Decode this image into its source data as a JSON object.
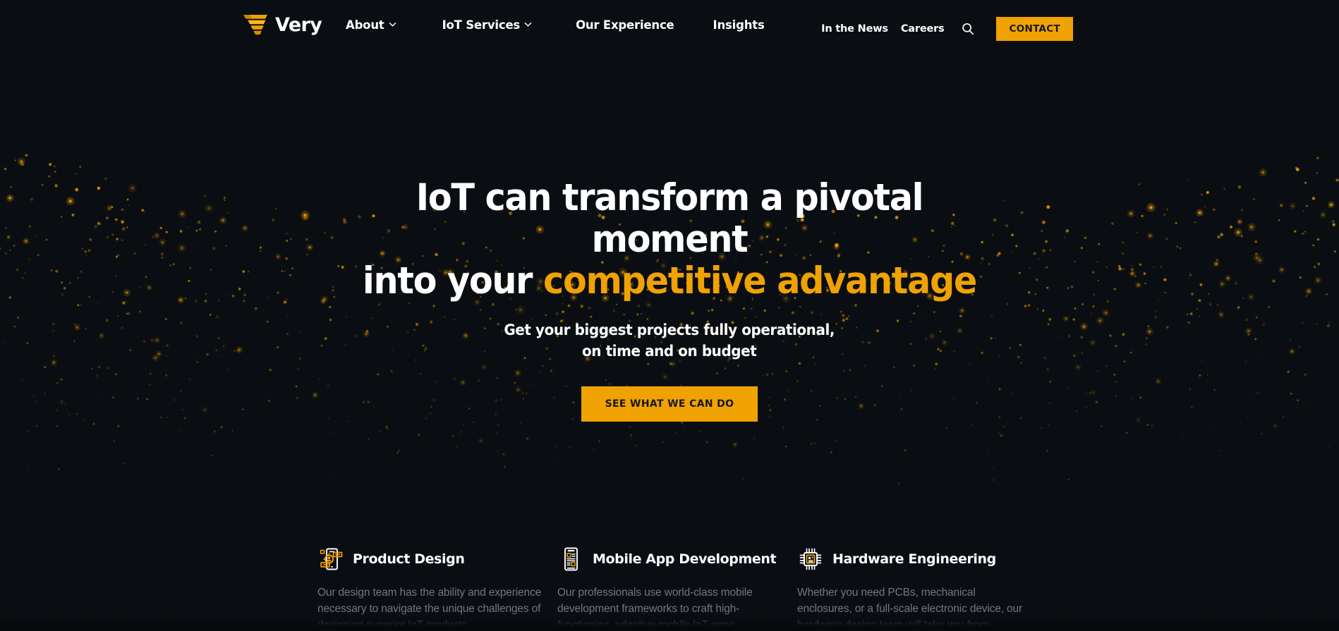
{
  "theme": {
    "bg": "#0a0e12",
    "accent": "#f0a202",
    "text": "#ffffff",
    "muted": "#6f777f",
    "btn_text": "#15171a"
  },
  "header": {
    "logo": {
      "icon": "very-funnel-logo-icon",
      "text": "Very"
    },
    "nav": [
      {
        "label": "About",
        "has_dropdown": true,
        "icon": "chevron-down-icon"
      },
      {
        "label": "IoT Services",
        "has_dropdown": true,
        "icon": "chevron-down-icon"
      },
      {
        "label": "Our Experience",
        "has_dropdown": false
      },
      {
        "label": "Insights",
        "has_dropdown": false
      }
    ],
    "utility": {
      "news_label": "In the News",
      "careers_label": "Careers",
      "search_icon": "search-icon",
      "contact_label": "CONTACT"
    }
  },
  "hero": {
    "headline_line1": "IoT can transform a pivotal moment",
    "headline_line2_prefix": "into your ",
    "headline_line2_accent": "competitive advantage",
    "subhead_line1": "Get your biggest projects fully operational,",
    "subhead_line2": "on time and on budget",
    "cta_label": "SEE WHAT WE CAN DO"
  },
  "services": [
    {
      "icon": "product-design-icon",
      "title": "Product Design",
      "body": "Our design team has the ability and experience necessary to navigate the unique challenges of designing superior IoT products."
    },
    {
      "icon": "mobile-app-icon",
      "title": "Mobile App Development",
      "body": "Our professionals use world-class mobile development frameworks to craft high-functioning, adaptive mobile IoT apps."
    },
    {
      "icon": "hardware-chip-icon",
      "title": "Hardware Engineering",
      "body": "Whether you need PCBs, mechanical enclosures, or a full-scale electronic device, our hardware design team will take you from"
    }
  ]
}
